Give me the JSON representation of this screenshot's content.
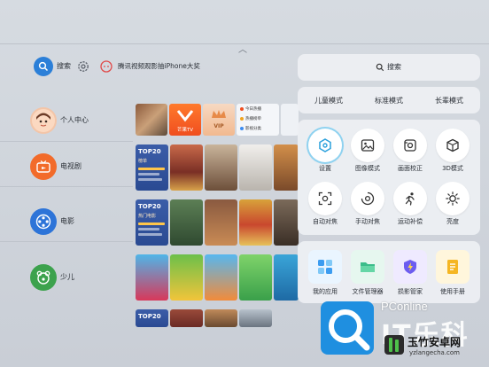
{
  "header": {
    "search_label": "搜索",
    "promo_text": "腾讯视频观影抽iPhone大奖",
    "chevron_glyph": "︿"
  },
  "sidebar": {
    "items": [
      {
        "label": "个人中心",
        "icon": "avatar-icon"
      },
      {
        "label": "电视剧",
        "icon": "tv-icon"
      },
      {
        "label": "电影",
        "icon": "film-reel-icon"
      },
      {
        "label": "少儿",
        "icon": "kids-icon"
      }
    ]
  },
  "content": {
    "row1_mini": {
      "brand": "芒果TV",
      "vip": "VIP",
      "links": [
        "今日热播",
        "热播榜单",
        "影视分类"
      ]
    },
    "row2_badge": {
      "top": "TOP20",
      "sub": "榜单"
    },
    "row3_badge": {
      "top": "TOP20",
      "sub": "热门电影"
    },
    "row4_badge": {
      "top": "TOP20"
    }
  },
  "panel": {
    "search_label": "搜索",
    "modes": [
      "儿童模式",
      "标准模式",
      "长辈模式"
    ],
    "quick_settings": [
      {
        "label": "设置",
        "icon": "hexagon-settings-icon",
        "active": true
      },
      {
        "label": "图像模式",
        "icon": "image-icon",
        "active": false
      },
      {
        "label": "画面校正",
        "icon": "screen-correct-icon",
        "active": false
      },
      {
        "label": "3D模式",
        "icon": "cube-icon",
        "active": false
      },
      {
        "label": "自动对焦",
        "icon": "auto-focus-icon",
        "active": false
      },
      {
        "label": "手动对焦",
        "icon": "manual-focus-icon",
        "active": false
      },
      {
        "label": "运动补偿",
        "icon": "running-icon",
        "active": false
      },
      {
        "label": "亮度",
        "icon": "brightness-icon",
        "active": false
      }
    ],
    "apps": [
      {
        "label": "我的应用",
        "icon": "apps-grid-icon",
        "color": "#eaf5ff"
      },
      {
        "label": "文件管理器",
        "icon": "folder-icon",
        "color": "#e6f7ef"
      },
      {
        "label": "损影管家",
        "icon": "shield-icon",
        "color": "#efeaff"
      },
      {
        "label": "使用手册",
        "icon": "manual-icon",
        "color": "#fff6dc"
      }
    ]
  },
  "watermark": {
    "brand": "PConline",
    "site_cn": "玉竹安卓网",
    "site_url": "yzlangecha.com",
    "big_text": "IT乐科"
  },
  "colors": {
    "accent": "#2b7fd8",
    "brand_orange": "#ff6a1f",
    "tv_orange": "#f26b2a",
    "film_blue": "#2d74d8",
    "kids_green": "#3ca24d"
  }
}
